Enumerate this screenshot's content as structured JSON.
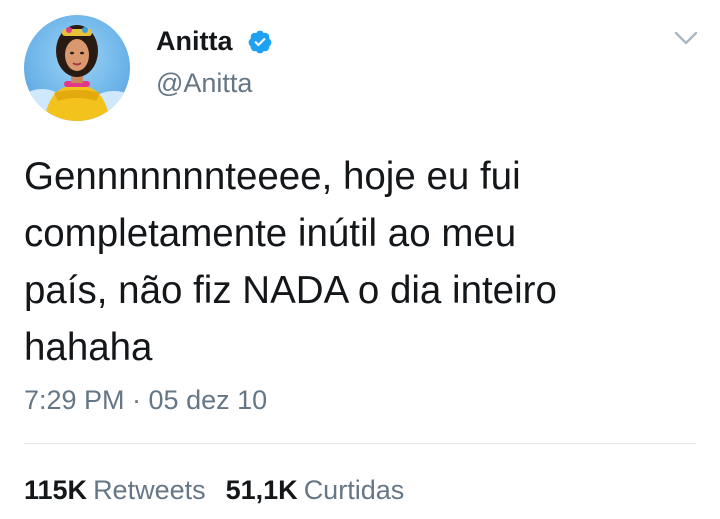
{
  "tweet": {
    "author": {
      "name": "Anitta",
      "handle": "@Anitta",
      "verified_icon": "verified-badge-icon",
      "avatar_icon": "profile-photo"
    },
    "menu_icon": "chevron-down-icon",
    "text": "Gennnnnnnteeee, hoje eu fui\ncompletamente inútil ao meu\npaís, não fiz NADA o dia inteiro\nhahaha",
    "timestamp": "7:29 PM · 05 dez 10",
    "stats": {
      "retweets_count": "115K",
      "retweets_label": "Retweets",
      "likes_count": "51,1K",
      "likes_label": "Curtidas"
    }
  },
  "colors": {
    "text": "#14171a",
    "secondary": "#657786",
    "verified": "#1da1f2",
    "divider": "#e1e8ed"
  }
}
